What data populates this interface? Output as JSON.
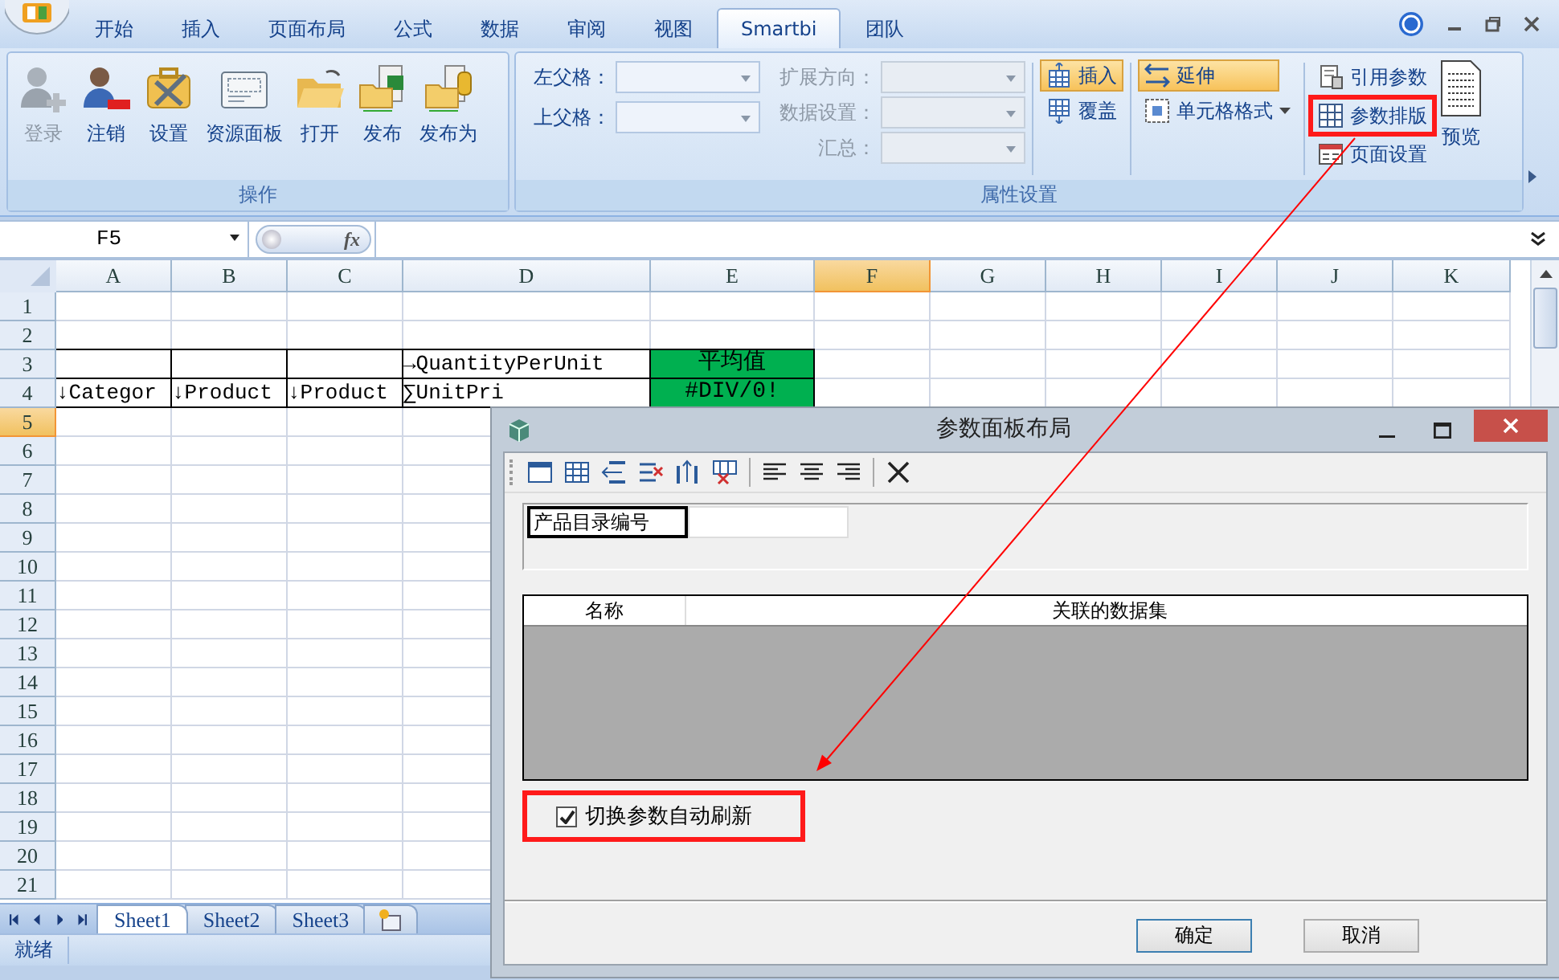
{
  "tabs": [
    {
      "label": "开始",
      "selected": false
    },
    {
      "label": "插入",
      "selected": false
    },
    {
      "label": "页面布局",
      "selected": false
    },
    {
      "label": "公式",
      "selected": false
    },
    {
      "label": "数据",
      "selected": false
    },
    {
      "label": "审阅",
      "selected": false
    },
    {
      "label": "视图",
      "selected": false
    },
    {
      "label": "Smartbi",
      "selected": true
    },
    {
      "label": "团队",
      "selected": false
    }
  ],
  "ribbon": {
    "groups": [
      {
        "kind": "buttons",
        "label": "操作",
        "buttons": [
          {
            "label": "登录",
            "disabled": true
          },
          {
            "label": "注销",
            "disabled": false
          },
          {
            "label": "设置",
            "disabled": false
          },
          {
            "label": "资源面板",
            "disabled": false
          },
          {
            "label": "打开",
            "disabled": false
          },
          {
            "label": "发布",
            "disabled": false
          },
          {
            "label": "发布为",
            "disabled": false
          }
        ]
      },
      {
        "kind": "properties",
        "label": "属性设置",
        "parent_fields": [
          {
            "label": "左父格：",
            "disabled": false
          },
          {
            "label": "上父格：",
            "disabled": false
          }
        ],
        "setting_fields": [
          {
            "label": "扩展方向：",
            "disabled": true
          },
          {
            "label": "数据设置：",
            "disabled": true
          },
          {
            "label": "汇总：",
            "disabled": true
          }
        ],
        "mode_buttons": [
          {
            "label": "插入",
            "on": true
          },
          {
            "label": "覆盖",
            "on": false
          }
        ],
        "fill_buttons": [
          {
            "label": "延伸",
            "on": true
          },
          {
            "label": "单元格格式",
            "on": false
          }
        ],
        "param_buttons": [
          {
            "label": "引用参数",
            "annotated": false
          },
          {
            "label": "参数排版",
            "annotated": true
          },
          {
            "label": "页面设置",
            "annotated": false
          }
        ],
        "preview_button": {
          "label": "预览"
        }
      }
    ]
  },
  "formula_bar": {
    "name_box": "F5",
    "function_button": "fx"
  },
  "sheet": {
    "columns": [
      {
        "label": "A",
        "selected": false
      },
      {
        "label": "B",
        "selected": false
      },
      {
        "label": "C",
        "selected": false
      },
      {
        "label": "D",
        "selected": false
      },
      {
        "label": "E",
        "selected": false
      },
      {
        "label": "F",
        "selected": true
      },
      {
        "label": "G",
        "selected": false
      },
      {
        "label": "H",
        "selected": false
      },
      {
        "label": "I",
        "selected": false
      },
      {
        "label": "J",
        "selected": false
      },
      {
        "label": "K",
        "selected": false
      }
    ],
    "rows": [
      {
        "label": "1",
        "selected": false
      },
      {
        "label": "2",
        "selected": false
      },
      {
        "label": "3",
        "selected": false,
        "cells": [
          {
            "highlighted": false
          },
          {
            "highlighted": false
          },
          {
            "highlighted": false
          },
          {
            "text": "→QuantityPerUnit",
            "highlighted": false
          },
          {
            "text": "平均值",
            "highlighted": true
          }
        ]
      },
      {
        "label": "4",
        "selected": false,
        "cells": [
          {
            "text": "↓Categor",
            "highlighted": false
          },
          {
            "text": "↓Product",
            "highlighted": false
          },
          {
            "text": "↓Product",
            "highlighted": false
          },
          {
            "text": "∑UnitPri",
            "highlighted": false
          },
          {
            "text": "#DIV/0!",
            "highlighted": true
          }
        ]
      },
      {
        "label": "5",
        "selected": true
      },
      {
        "label": "6",
        "selected": false
      },
      {
        "label": "7",
        "selected": false
      },
      {
        "label": "8",
        "selected": false
      },
      {
        "label": "9",
        "selected": false
      },
      {
        "label": "10",
        "selected": false
      },
      {
        "label": "11",
        "selected": false
      },
      {
        "label": "12",
        "selected": false
      },
      {
        "label": "13",
        "selected": false
      },
      {
        "label": "14",
        "selected": false
      },
      {
        "label": "15",
        "selected": false
      },
      {
        "label": "16",
        "selected": false
      },
      {
        "label": "17",
        "selected": false
      },
      {
        "label": "18",
        "selected": false
      },
      {
        "label": "19",
        "selected": false
      },
      {
        "label": "20",
        "selected": false
      },
      {
        "label": "21",
        "selected": false
      }
    ]
  },
  "sheet_tabs": [
    {
      "label": "Sheet1",
      "selected": true
    },
    {
      "label": "Sheet2",
      "selected": false
    },
    {
      "label": "Sheet3",
      "selected": false
    }
  ],
  "status_bar": {
    "text": "就绪"
  },
  "dialog": {
    "title": "参数面板布局",
    "layout_items": [
      {
        "label": "产品目录编号",
        "selected": true
      }
    ],
    "table": {
      "columns": [
        "名称",
        "关联的数据集"
      ]
    },
    "checkbox": {
      "label": "切换参数自动刷新",
      "checked": true,
      "annotated": true
    },
    "buttons": [
      "确定",
      "取消"
    ]
  }
}
